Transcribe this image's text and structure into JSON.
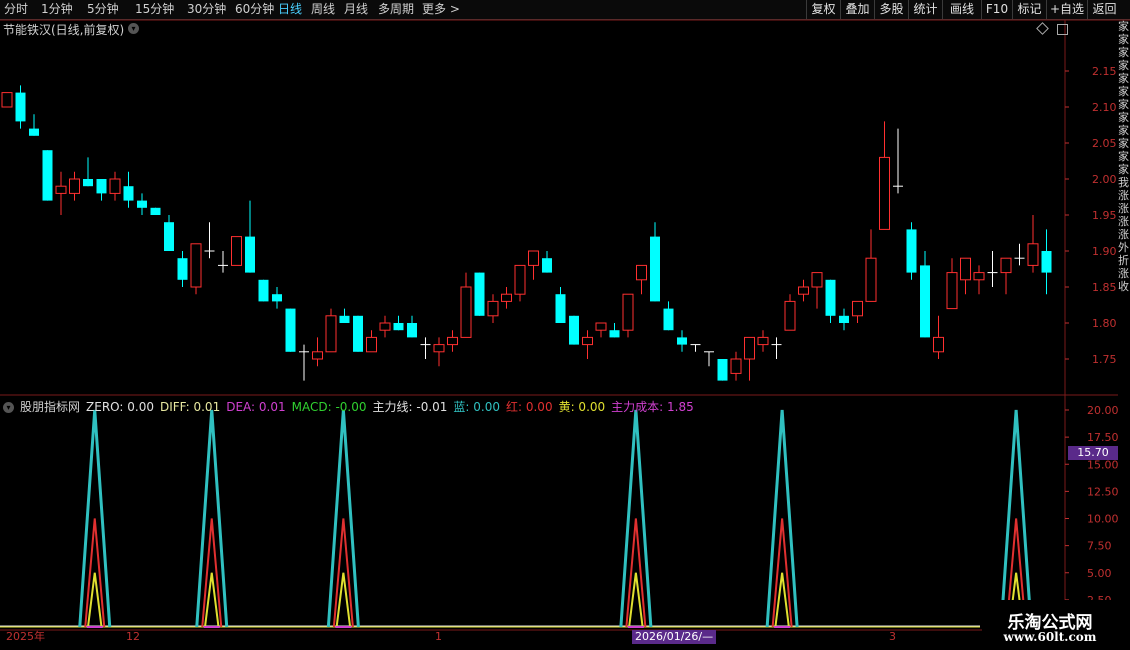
{
  "toolbar": {
    "periods": [
      "分时",
      "1分钟",
      "5分钟",
      "15分钟",
      "30分钟",
      "60分钟",
      "日线",
      "周线",
      "月线",
      "多周期",
      "更多 >"
    ],
    "active_period": "日线",
    "right_buttons": [
      "复权",
      "叠加",
      "多股",
      "统计",
      "画线",
      "F10",
      "标记",
      "+自选",
      "返回"
    ]
  },
  "stock_panel": {
    "title": "节能铁汉(日线,前复权)",
    "price_ticks": [
      "2.15",
      "2.10",
      "2.05",
      "2.00",
      "1.95",
      "1.90",
      "1.85",
      "1.80",
      "1.75"
    ]
  },
  "indicator_panel": {
    "name": "股朋指标网",
    "values": [
      {
        "label": "ZERO: 0.00",
        "color": "#e0e0e0"
      },
      {
        "label": "DIFF: 0.01",
        "color": "#e8e8a0"
      },
      {
        "label": "DEA: 0.01",
        "color": "#d040d0"
      },
      {
        "label": "MACD: -0.00",
        "color": "#30d030"
      },
      {
        "label": "主力线: -0.01",
        "color": "#e0e0e0"
      },
      {
        "label": "蓝: 0.00",
        "color": "#30c0c0"
      },
      {
        "label": "红: 0.00",
        "color": "#e03030"
      },
      {
        "label": "黄: 0.00",
        "color": "#e0e030"
      },
      {
        "label": "主力成本: 1.85",
        "color": "#d040d0"
      }
    ],
    "ticks": [
      "20.00",
      "17.50",
      "15.00",
      "12.50",
      "10.00",
      "7.50",
      "5.00",
      "2.50"
    ],
    "price_badge": "15.70"
  },
  "date_axis": {
    "labels": [
      "2025年",
      "12",
      "1",
      "3"
    ],
    "badge": "2026/01/26/—"
  },
  "right_strip_text": "家家家家家家家家家家家家我涨涨涨涨外折涨收",
  "watermark": {
    "name": "乐淘公式网",
    "url": "www.60lt.com"
  },
  "colors": {
    "up": "#ff3030",
    "down": "#00ffff",
    "grid": "#7a1a1a",
    "accent": "#4ad0ff"
  },
  "chart_data": [
    {
      "type": "candlestick",
      "title": "节能铁汉(日线,前复权)",
      "ylim": [
        1.7,
        2.2
      ],
      "candles": [
        {
          "o": 2.1,
          "h": 2.12,
          "l": 2.1,
          "c": 2.12
        },
        {
          "o": 2.12,
          "h": 2.13,
          "l": 2.07,
          "c": 2.08
        },
        {
          "o": 2.07,
          "h": 2.09,
          "l": 2.06,
          "c": 2.06
        },
        {
          "o": 2.04,
          "h": 2.04,
          "l": 1.97,
          "c": 1.97
        },
        {
          "o": 1.98,
          "h": 2.01,
          "l": 1.95,
          "c": 1.99
        },
        {
          "o": 1.98,
          "h": 2.01,
          "l": 1.97,
          "c": 2.0
        },
        {
          "o": 2.0,
          "h": 2.03,
          "l": 1.99,
          "c": 1.99
        },
        {
          "o": 2.0,
          "h": 2.0,
          "l": 1.97,
          "c": 1.98
        },
        {
          "o": 1.98,
          "h": 2.01,
          "l": 1.97,
          "c": 2.0
        },
        {
          "o": 1.99,
          "h": 2.01,
          "l": 1.96,
          "c": 1.97
        },
        {
          "o": 1.97,
          "h": 1.98,
          "l": 1.95,
          "c": 1.96
        },
        {
          "o": 1.96,
          "h": 1.96,
          "l": 1.95,
          "c": 1.95
        },
        {
          "o": 1.94,
          "h": 1.95,
          "l": 1.9,
          "c": 1.9
        },
        {
          "o": 1.89,
          "h": 1.9,
          "l": 1.85,
          "c": 1.86
        },
        {
          "o": 1.85,
          "h": 1.91,
          "l": 1.84,
          "c": 1.91
        },
        {
          "o": 1.9,
          "h": 1.94,
          "l": 1.89,
          "c": 1.9
        },
        {
          "o": 1.88,
          "h": 1.9,
          "l": 1.87,
          "c": 1.88
        },
        {
          "o": 1.88,
          "h": 1.92,
          "l": 1.88,
          "c": 1.92
        },
        {
          "o": 1.92,
          "h": 1.97,
          "l": 1.87,
          "c": 1.87
        },
        {
          "o": 1.86,
          "h": 1.86,
          "l": 1.83,
          "c": 1.83
        },
        {
          "o": 1.84,
          "h": 1.85,
          "l": 1.82,
          "c": 1.83
        },
        {
          "o": 1.82,
          "h": 1.82,
          "l": 1.76,
          "c": 1.76
        },
        {
          "o": 1.76,
          "h": 1.77,
          "l": 1.72,
          "c": 1.76
        },
        {
          "o": 1.75,
          "h": 1.78,
          "l": 1.74,
          "c": 1.76
        },
        {
          "o": 1.76,
          "h": 1.82,
          "l": 1.76,
          "c": 1.81
        },
        {
          "o": 1.81,
          "h": 1.82,
          "l": 1.8,
          "c": 1.8
        },
        {
          "o": 1.81,
          "h": 1.81,
          "l": 1.76,
          "c": 1.76
        },
        {
          "o": 1.76,
          "h": 1.79,
          "l": 1.76,
          "c": 1.78
        },
        {
          "o": 1.79,
          "h": 1.81,
          "l": 1.78,
          "c": 1.8
        },
        {
          "o": 1.8,
          "h": 1.81,
          "l": 1.79,
          "c": 1.79
        },
        {
          "o": 1.8,
          "h": 1.81,
          "l": 1.78,
          "c": 1.78
        },
        {
          "o": 1.77,
          "h": 1.78,
          "l": 1.75,
          "c": 1.77
        },
        {
          "o": 1.76,
          "h": 1.78,
          "l": 1.74,
          "c": 1.77
        },
        {
          "o": 1.77,
          "h": 1.79,
          "l": 1.76,
          "c": 1.78
        },
        {
          "o": 1.78,
          "h": 1.87,
          "l": 1.78,
          "c": 1.85
        },
        {
          "o": 1.87,
          "h": 1.87,
          "l": 1.81,
          "c": 1.81
        },
        {
          "o": 1.81,
          "h": 1.84,
          "l": 1.8,
          "c": 1.83
        },
        {
          "o": 1.83,
          "h": 1.85,
          "l": 1.82,
          "c": 1.84
        },
        {
          "o": 1.84,
          "h": 1.88,
          "l": 1.83,
          "c": 1.88
        },
        {
          "o": 1.88,
          "h": 1.9,
          "l": 1.86,
          "c": 1.9
        },
        {
          "o": 1.89,
          "h": 1.9,
          "l": 1.87,
          "c": 1.87
        },
        {
          "o": 1.84,
          "h": 1.85,
          "l": 1.8,
          "c": 1.8
        },
        {
          "o": 1.81,
          "h": 1.81,
          "l": 1.77,
          "c": 1.77
        },
        {
          "o": 1.77,
          "h": 1.79,
          "l": 1.75,
          "c": 1.78
        },
        {
          "o": 1.79,
          "h": 1.8,
          "l": 1.78,
          "c": 1.8
        },
        {
          "o": 1.79,
          "h": 1.8,
          "l": 1.78,
          "c": 1.78
        },
        {
          "o": 1.79,
          "h": 1.84,
          "l": 1.78,
          "c": 1.84
        },
        {
          "o": 1.86,
          "h": 1.88,
          "l": 1.84,
          "c": 1.88
        },
        {
          "o": 1.92,
          "h": 1.94,
          "l": 1.83,
          "c": 1.83
        },
        {
          "o": 1.82,
          "h": 1.83,
          "l": 1.79,
          "c": 1.79
        },
        {
          "o": 1.78,
          "h": 1.79,
          "l": 1.76,
          "c": 1.77
        },
        {
          "o": 1.77,
          "h": 1.77,
          "l": 1.76,
          "c": 1.77
        },
        {
          "o": 1.76,
          "h": 1.76,
          "l": 1.74,
          "c": 1.76
        },
        {
          "o": 1.75,
          "h": 1.75,
          "l": 1.72,
          "c": 1.72
        },
        {
          "o": 1.73,
          "h": 1.76,
          "l": 1.72,
          "c": 1.75
        },
        {
          "o": 1.75,
          "h": 1.78,
          "l": 1.72,
          "c": 1.78
        },
        {
          "o": 1.77,
          "h": 1.79,
          "l": 1.76,
          "c": 1.78
        },
        {
          "o": 1.77,
          "h": 1.78,
          "l": 1.75,
          "c": 1.77
        },
        {
          "o": 1.79,
          "h": 1.84,
          "l": 1.79,
          "c": 1.83
        },
        {
          "o": 1.84,
          "h": 1.86,
          "l": 1.83,
          "c": 1.85
        },
        {
          "o": 1.85,
          "h": 1.87,
          "l": 1.82,
          "c": 1.87
        },
        {
          "o": 1.86,
          "h": 1.86,
          "l": 1.8,
          "c": 1.81
        },
        {
          "o": 1.81,
          "h": 1.82,
          "l": 1.79,
          "c": 1.8
        },
        {
          "o": 1.81,
          "h": 1.83,
          "l": 1.8,
          "c": 1.83
        },
        {
          "o": 1.83,
          "h": 1.93,
          "l": 1.83,
          "c": 1.89
        },
        {
          "o": 1.93,
          "h": 2.08,
          "l": 1.93,
          "c": 2.03
        },
        {
          "o": 1.99,
          "h": 2.07,
          "l": 1.98,
          "c": 1.99
        },
        {
          "o": 1.93,
          "h": 1.94,
          "l": 1.86,
          "c": 1.87
        },
        {
          "o": 1.88,
          "h": 1.9,
          "l": 1.78,
          "c": 1.78
        },
        {
          "o": 1.76,
          "h": 1.81,
          "l": 1.75,
          "c": 1.78
        },
        {
          "o": 1.82,
          "h": 1.89,
          "l": 1.82,
          "c": 1.87
        },
        {
          "o": 1.86,
          "h": 1.89,
          "l": 1.84,
          "c": 1.89
        },
        {
          "o": 1.86,
          "h": 1.88,
          "l": 1.84,
          "c": 1.87
        },
        {
          "o": 1.87,
          "h": 1.9,
          "l": 1.85,
          "c": 1.87
        },
        {
          "o": 1.87,
          "h": 1.89,
          "l": 1.84,
          "c": 1.89
        },
        {
          "o": 1.89,
          "h": 1.91,
          "l": 1.88,
          "c": 1.89
        },
        {
          "o": 1.88,
          "h": 1.95,
          "l": 1.87,
          "c": 1.91
        },
        {
          "o": 1.9,
          "h": 1.93,
          "l": 1.84,
          "c": 1.87
        }
      ]
    },
    {
      "type": "line",
      "title": "股朋指标网",
      "ylim": [
        0,
        20
      ],
      "peak_positions": [
        6,
        14,
        23,
        43,
        53,
        69
      ],
      "total_periods": 72,
      "series": [
        {
          "name": "蓝",
          "color": "#30c0c0",
          "peak": 20
        },
        {
          "name": "红",
          "color": "#e03030",
          "peak": 10
        },
        {
          "name": "黄",
          "color": "#e0e030",
          "peak": 5
        }
      ]
    }
  ]
}
